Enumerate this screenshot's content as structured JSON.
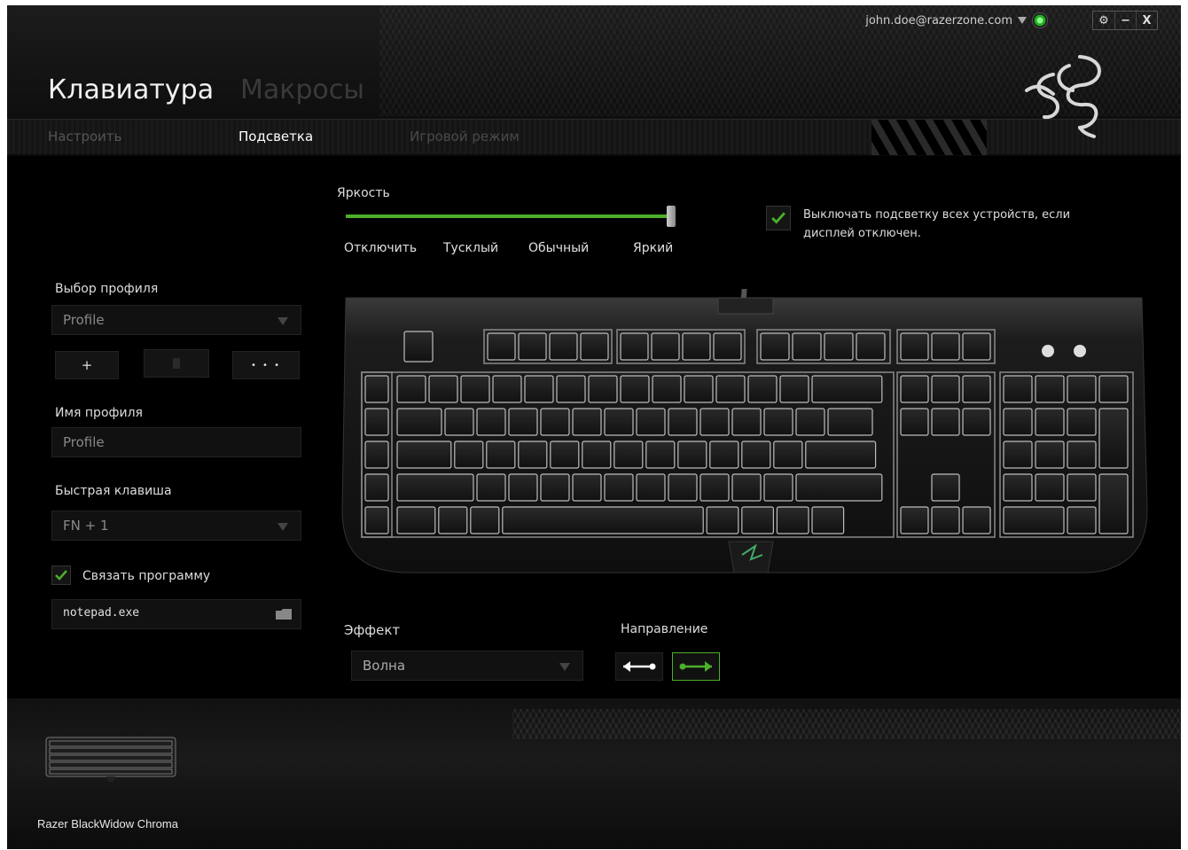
{
  "window": {
    "account_email": "john.doe@razerzone.com",
    "controls": [
      "⚙",
      "−",
      "X"
    ]
  },
  "header": {
    "tabs": [
      {
        "label": "Клавиатура",
        "active": true
      },
      {
        "label": "Макросы",
        "active": false
      }
    ],
    "subtabs": [
      {
        "label": "Настроить",
        "active": false
      },
      {
        "label": "Подсветка",
        "active": true
      },
      {
        "label": "Игровой режим",
        "active": false
      }
    ]
  },
  "profile": {
    "select_label": "Выбор профиля",
    "selected_profile": "Profile",
    "add_label": "+",
    "more_label": "• • •",
    "name_label": "Имя профиля",
    "name_value": "Profile",
    "hotkey_label": "Быстрая клавиша",
    "hotkey_value": "FN + 1",
    "link_program_label": "Связать программу",
    "link_program_checked": true,
    "program_value": "notepad.exe"
  },
  "brightness": {
    "label": "Яркость",
    "levels": [
      "Отключить",
      "Тусклый",
      "Обычный",
      "Яркий"
    ],
    "selected_level": "Яркий",
    "value": 1.0
  },
  "display_off": {
    "label_line1": "Выключать подсветку всех устройств, если",
    "label_line2": "дисплей отключен.",
    "checked": true
  },
  "effect": {
    "label": "Эффект",
    "value": "Волна"
  },
  "direction": {
    "label": "Направление",
    "selected": "right"
  },
  "footer": {
    "device_name": "Razer BlackWidow Chroma"
  },
  "colors": {
    "accent": "#4caf2a",
    "background": "#000000"
  }
}
